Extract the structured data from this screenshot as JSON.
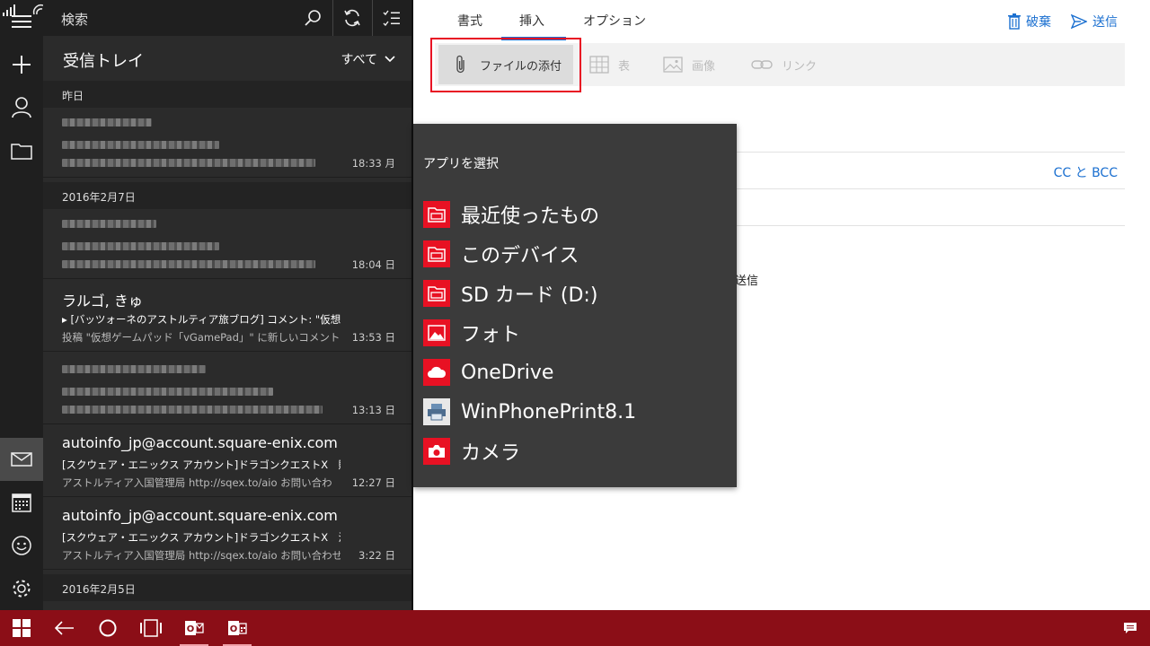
{
  "search": {
    "label": "検索"
  },
  "inbox": {
    "title": "受信トレイ",
    "filter": "すべて"
  },
  "groups": [
    "昨日",
    "2016年2月7日",
    "2016年2月5日"
  ],
  "mails": [
    {
      "from": "",
      "subject": "",
      "preview": "",
      "time": "18:33 月"
    },
    {
      "from": "",
      "subject": "",
      "preview": "",
      "time": "18:04 日"
    },
    {
      "from": "ラルゴ, きゅ",
      "subject": "[バッツォーネのアストルティア旅ブログ] コメント: \"仮想ゲーム",
      "preview": "投稿 \"仮想ゲームパッド「vGamePad」\" に新しいコメントがあ",
      "time": "13:53 日"
    },
    {
      "from": "",
      "subject": "",
      "preview": "",
      "time": "13:13 日"
    },
    {
      "from": "autoinfo_jp@account.square-enix.com",
      "subject": "[スクウェア・エニックス アカウント]ドラゴンクエストX　購入・変",
      "preview": "アストルティア入国管理局 http://sqex.to/aio お問い合わ",
      "time": "12:27 日"
    },
    {
      "from": "autoinfo_jp@account.square-enix.com",
      "subject": "[スクウェア・エニックス アカウント]ドラゴンクエストX　決済完了",
      "preview": "アストルティア入国管理局 http://sqex.to/aio お問い合わせ",
      "time": "3:22 日"
    }
  ],
  "compose": {
    "tabs": [
      "書式",
      "挿入",
      "オプション"
    ],
    "discard": "破棄",
    "send": "送信",
    "ribbon": {
      "attach": "ファイルの添付",
      "table": "表",
      "image": "画像",
      "link": "リンク"
    },
    "ccbcc": "CC と BCC",
    "signature_fragment": "送信"
  },
  "flyout": {
    "title": "アプリを選択",
    "items": [
      "最近使ったもの",
      "このデバイス",
      "SD カード (D:)",
      "フォト",
      "OneDrive",
      "WinPhonePrint8.1",
      "カメラ"
    ]
  },
  "colors": {
    "accent": "#1a6fd0",
    "taskbar": "#8b0e17",
    "highlight": "#e81123"
  }
}
